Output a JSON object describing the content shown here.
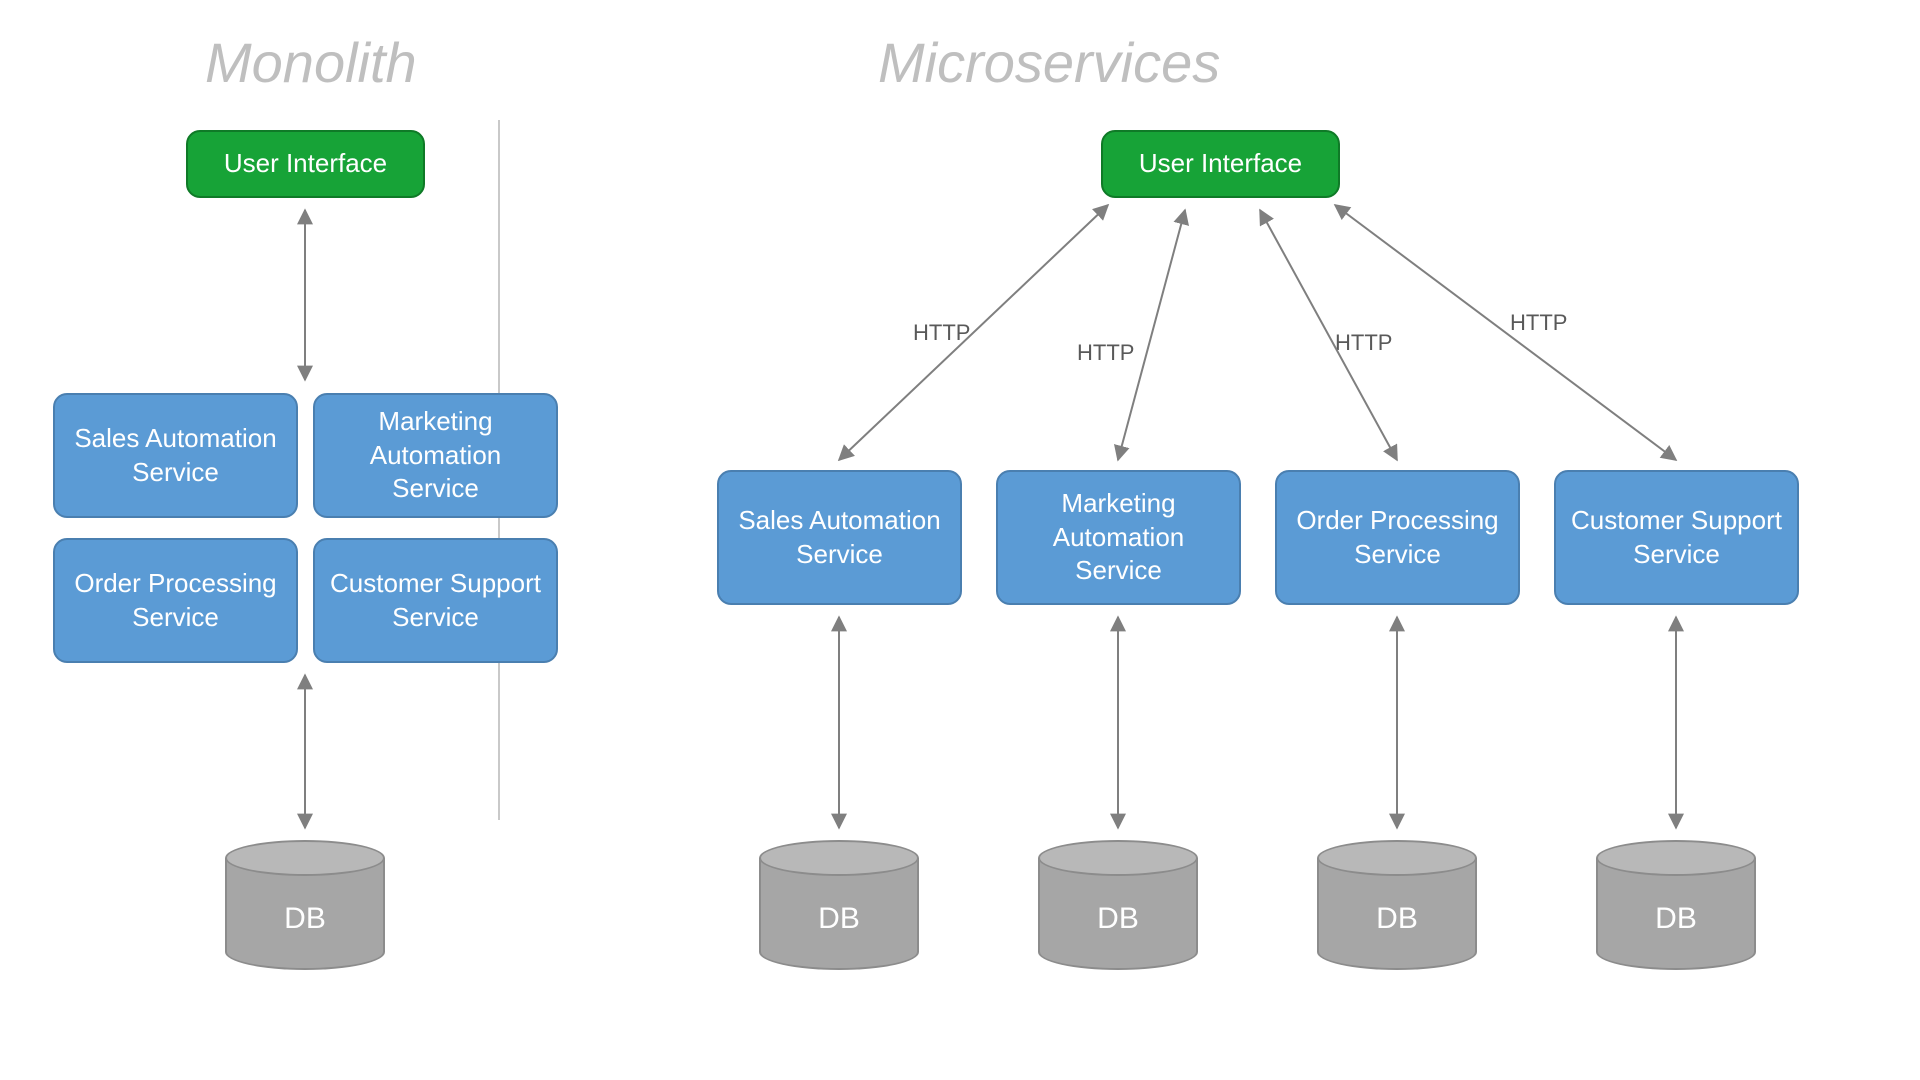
{
  "titles": {
    "left": "Monolith",
    "right": "Microservices"
  },
  "monolith": {
    "ui": "User Interface",
    "services": [
      "Sales Automation Service",
      "Marketing Automation Service",
      "Order Processing Service",
      "Customer Support Service"
    ],
    "db": "DB"
  },
  "microservices": {
    "ui": "User Interface",
    "edge_label": "HTTP",
    "services": [
      "Sales Automation Service",
      "Marketing Automation Service",
      "Order Processing Service",
      "Customer Support Service"
    ],
    "db": "DB"
  },
  "colors": {
    "green": "#17a337",
    "blue": "#5b9bd5",
    "gray_title": "#bfbfbf",
    "gray_cylinder": "#a6a6a6",
    "arrow": "#7f7f7f"
  }
}
